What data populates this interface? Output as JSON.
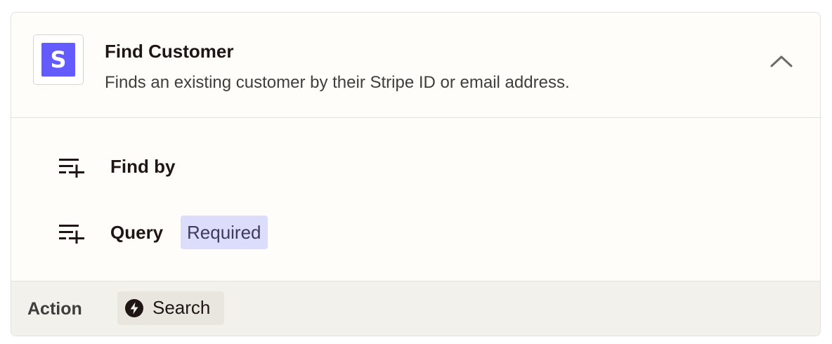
{
  "step": {
    "app_logo_letter": "S",
    "app_logo_icon": "stripe-icon",
    "title": "Find Customer",
    "description": "Finds an existing customer by their Stripe ID or email address.",
    "collapse_icon": "chevron-up-icon"
  },
  "fields": [
    {
      "label": "Find by",
      "icon": "add-field-icon",
      "badge": ""
    },
    {
      "label": "Query",
      "icon": "add-field-icon",
      "badge": "Required"
    }
  ],
  "footer": {
    "label": "Action",
    "chip_label": "Search",
    "chip_icon": "bolt-icon"
  },
  "colors": {
    "stripe_brand": "#635bff",
    "required_badge_bg": "#dcdcfb",
    "footer_bg": "#f3f1ec"
  }
}
